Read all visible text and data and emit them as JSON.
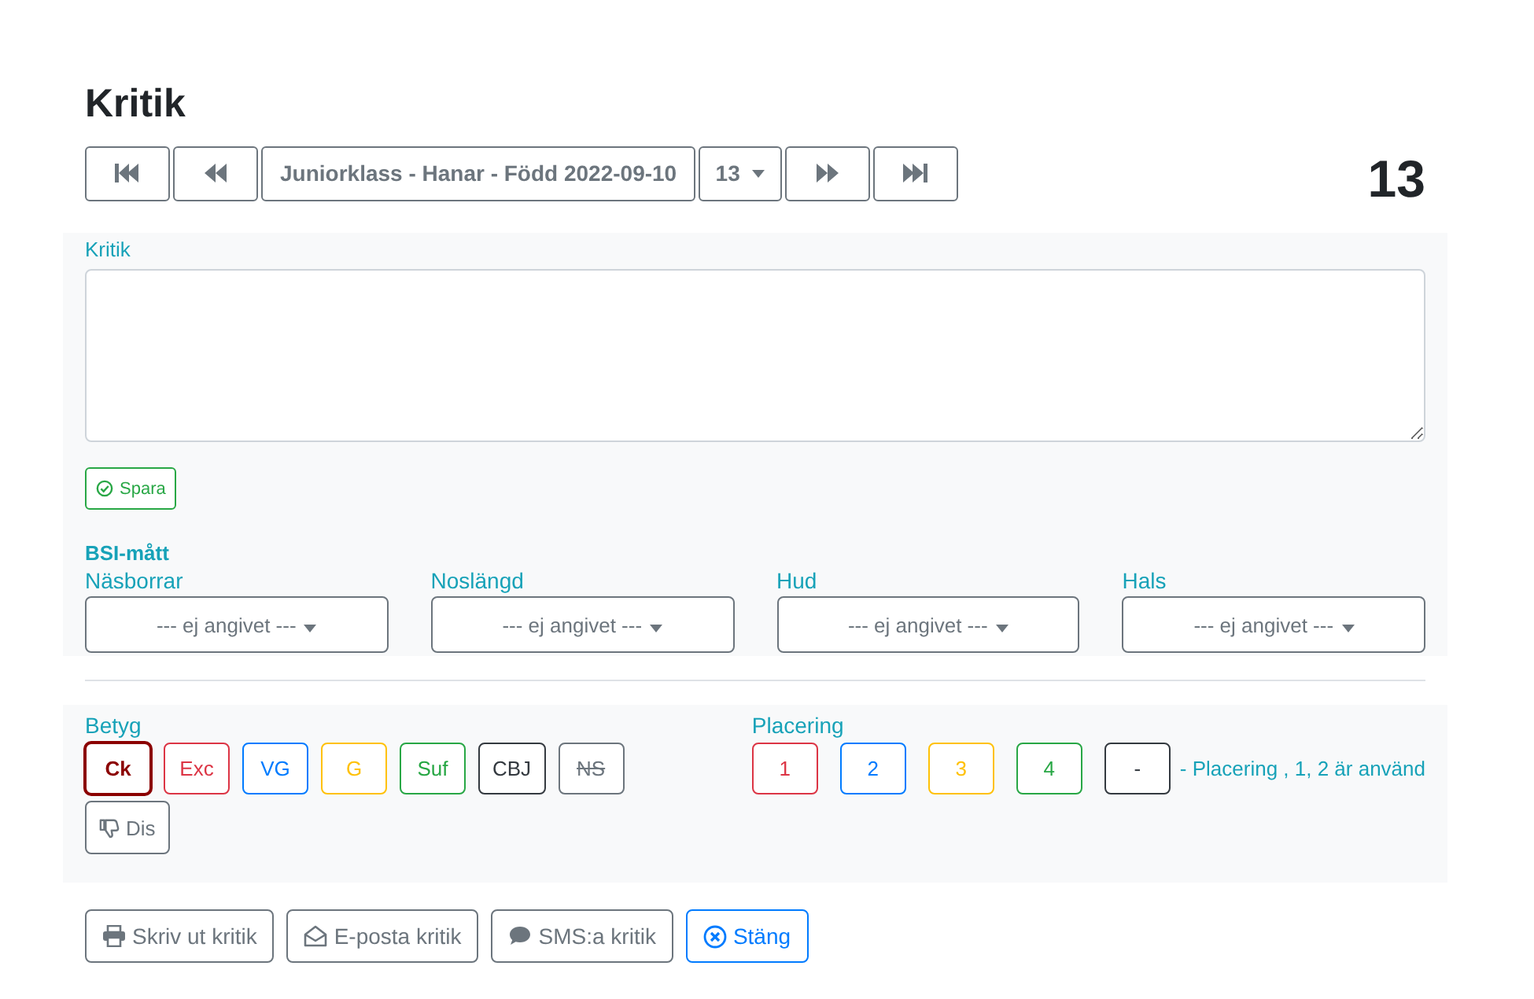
{
  "title": "Kritik",
  "nav": {
    "class_label": "Juniorklass - Hanar - Född 2022-09-10",
    "number_dropdown": "13",
    "current_number": "13"
  },
  "critique": {
    "label": "Kritik",
    "save_button": "Spara"
  },
  "bsi": {
    "heading": "BSI-mått",
    "fields": [
      {
        "label": "Näsborrar",
        "value": "--- ej angivet ---"
      },
      {
        "label": "Noslängd",
        "value": "--- ej angivet ---"
      },
      {
        "label": "Hud",
        "value": "--- ej angivet ---"
      },
      {
        "label": "Hals",
        "value": "--- ej angivet ---"
      }
    ]
  },
  "grades": {
    "label": "Betyg",
    "items": [
      {
        "label": "Ck",
        "color": "#8b0000",
        "selected": true,
        "disabled": false
      },
      {
        "label": "Exc",
        "color": "#dc3545",
        "selected": false,
        "disabled": false
      },
      {
        "label": "VG",
        "color": "#007bff",
        "selected": false,
        "disabled": false
      },
      {
        "label": "G",
        "color": "#ffc107",
        "selected": false,
        "disabled": false
      },
      {
        "label": "Suf",
        "color": "#28a745",
        "selected": false,
        "disabled": false
      },
      {
        "label": "CBJ",
        "color": "#343a40",
        "selected": false,
        "disabled": false
      },
      {
        "label": "NS",
        "color": "#6c757d",
        "selected": false,
        "disabled": true
      }
    ],
    "dis_button": "Dis"
  },
  "placement": {
    "label": "Placering",
    "items": [
      {
        "label": "1",
        "color": "#dc3545",
        "selected": false
      },
      {
        "label": "2",
        "color": "#007bff",
        "selected": false
      },
      {
        "label": "3",
        "color": "#ffc107",
        "selected": false
      },
      {
        "label": "4",
        "color": "#28a745",
        "selected": false
      },
      {
        "label": "-",
        "color": "#343a40",
        "selected": false
      }
    ],
    "note": "- Placering , 1, 2 är använd"
  },
  "actions": [
    {
      "kind": "print",
      "label": "Skriv ut kritik"
    },
    {
      "kind": "email",
      "label": "E-posta kritik"
    },
    {
      "kind": "sms",
      "label": "SMS:a kritik"
    },
    {
      "kind": "close",
      "label": "Stäng"
    }
  ]
}
